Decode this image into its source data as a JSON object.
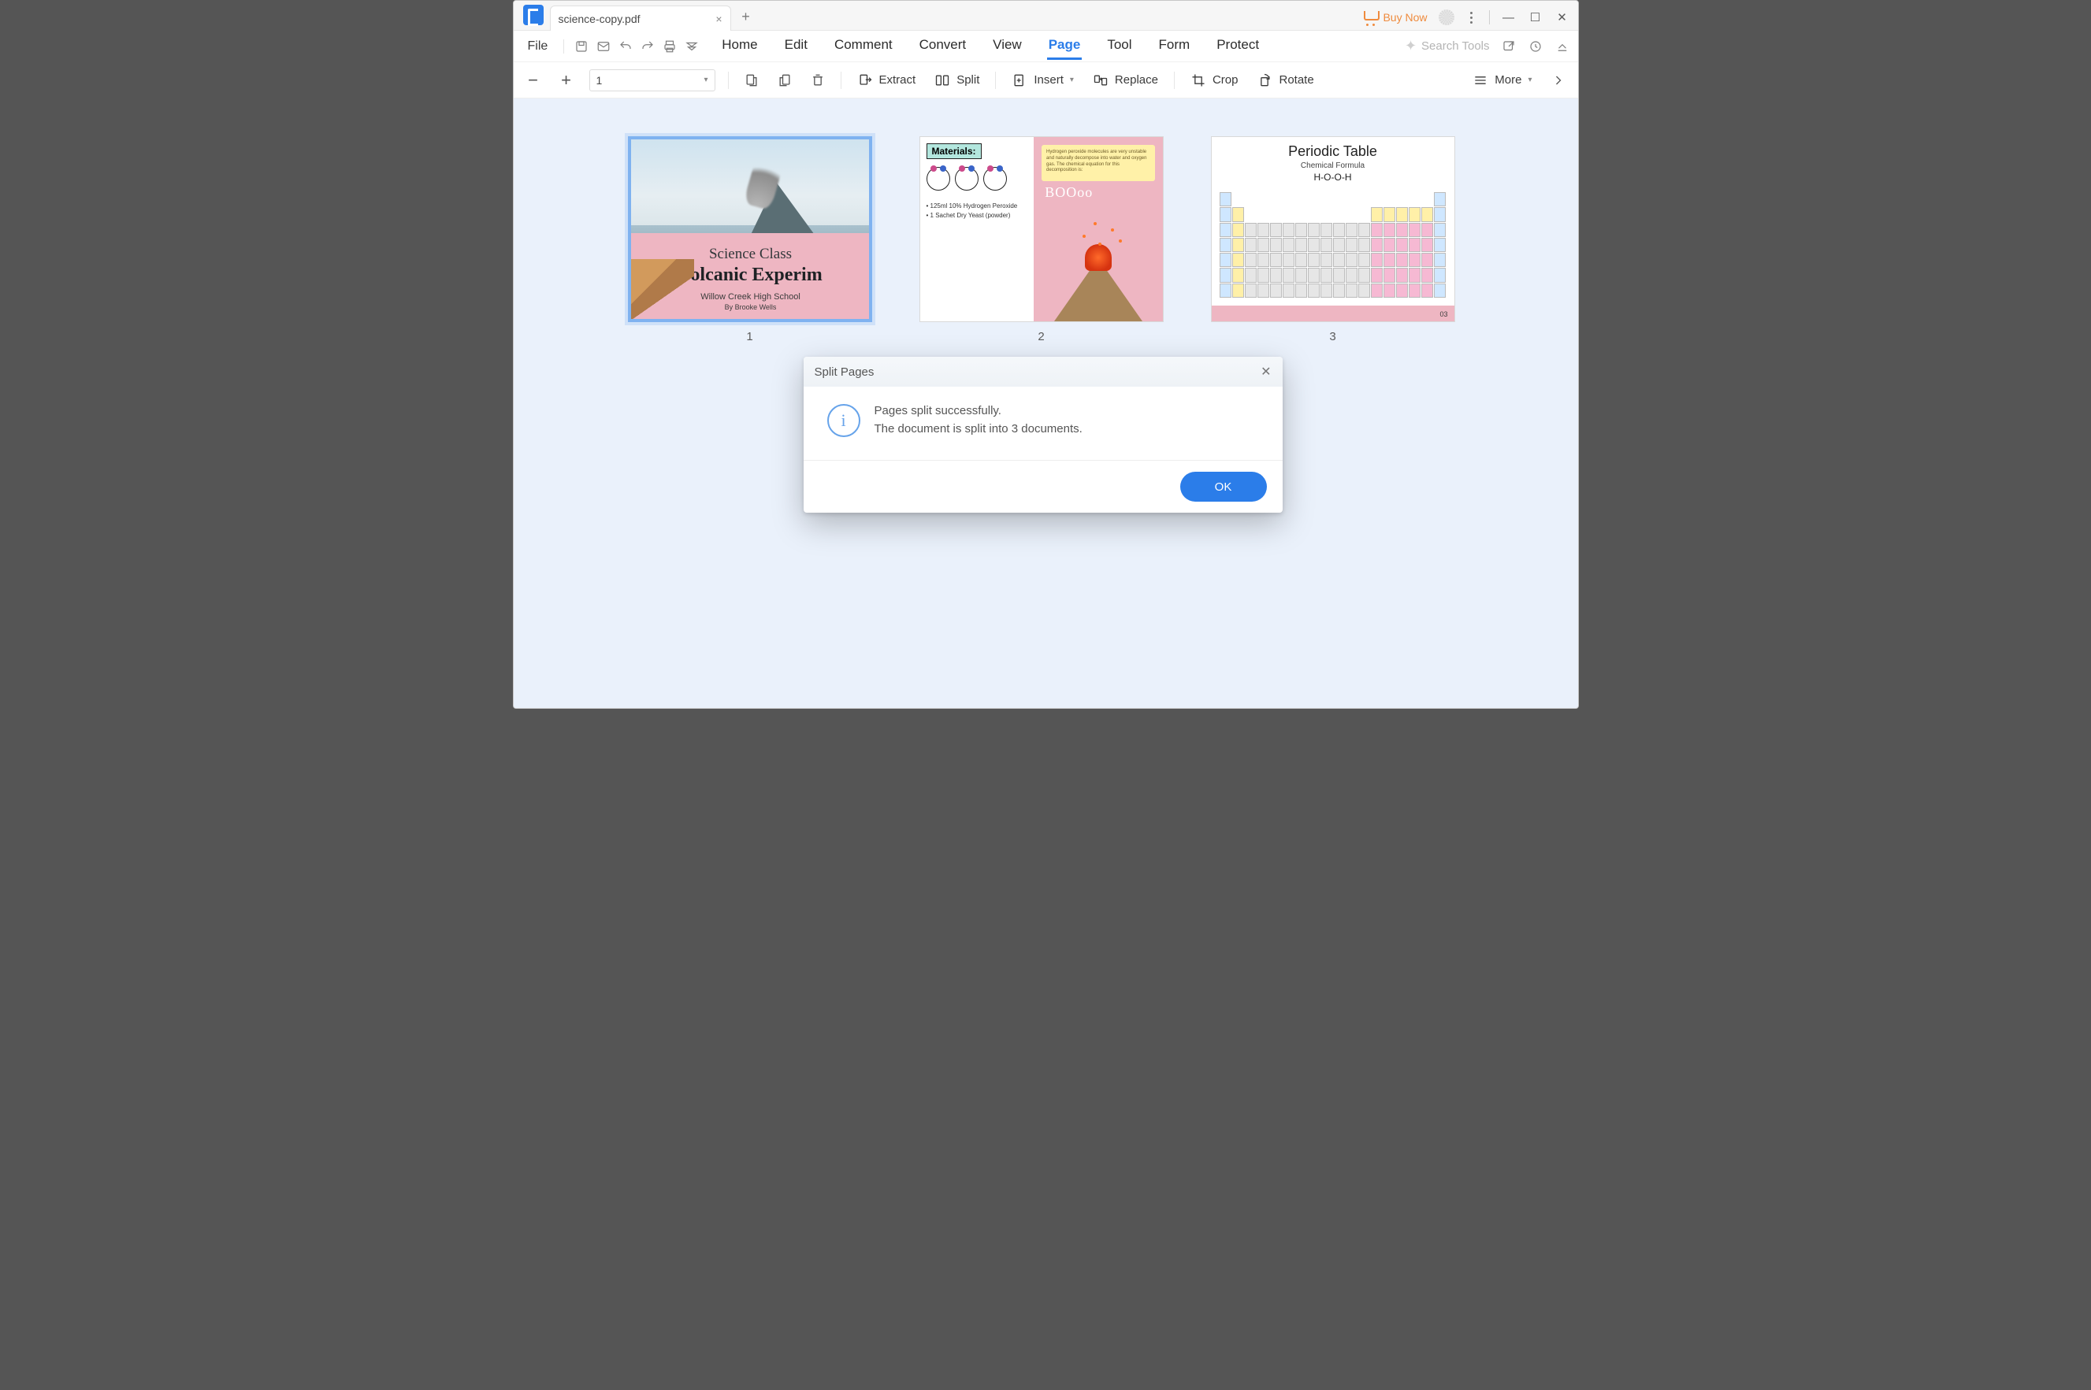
{
  "tab": {
    "title": "science-copy.pdf",
    "newtab_glyph": "+"
  },
  "titlebar": {
    "buynow": "Buy Now",
    "minimize_glyph": "—",
    "maximize_glyph": "☐",
    "close_glyph": "✕"
  },
  "menu": {
    "file": "File",
    "tabs": [
      "Home",
      "Edit",
      "Comment",
      "Convert",
      "View",
      "Page",
      "Tool",
      "Form",
      "Protect"
    ],
    "active_tab": "Page",
    "search_placeholder": "Search Tools"
  },
  "toolbar": {
    "page_value": "1",
    "extract": "Extract",
    "split": "Split",
    "insert": "Insert",
    "replace": "Replace",
    "crop": "Crop",
    "rotate": "Rotate",
    "more": "More"
  },
  "pages": {
    "selected_index": 0,
    "labels": [
      "1",
      "2",
      "3"
    ],
    "page1": {
      "line1": "Science Class",
      "line2": "Volcanic Experim",
      "line3": "Willow Creek High School",
      "line4": "By Brooke Wells"
    },
    "page2": {
      "materials_label": "Materials:",
      "bullets": "• 125ml 10% Hydrogen Peroxide\n• 1 Sachet Dry Yeast (powder)",
      "boom": "BOOoo"
    },
    "page3": {
      "title": "Periodic Table",
      "subtitle": "Chemical Formula",
      "formula": "H-O-O-H",
      "page_num": "03"
    }
  },
  "dialog": {
    "title": "Split Pages",
    "line1": "Pages split successfully.",
    "line2": "The document is split into 3 documents.",
    "ok": "OK",
    "info_glyph": "i",
    "close_glyph": "✕"
  },
  "colors": {
    "accent": "#2b7de9",
    "buynow": "#ef8b3e",
    "workspace": "#eaf1fb",
    "thumb_pink": "#eeb6c2"
  }
}
